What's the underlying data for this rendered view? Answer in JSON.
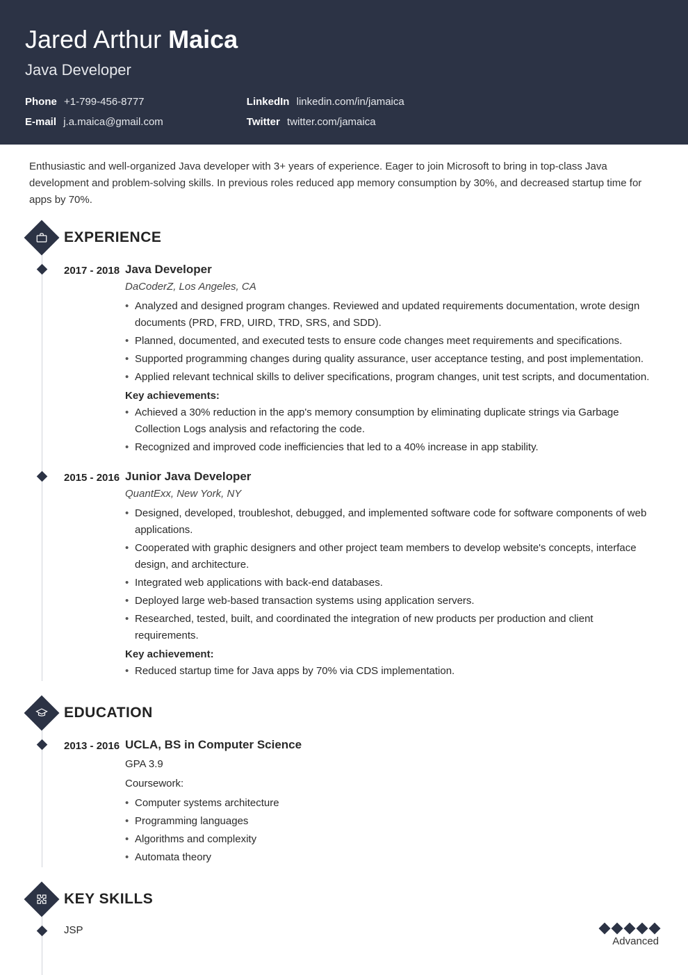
{
  "header": {
    "first_middle": "Jared Arthur",
    "last": "Maica",
    "title": "Java Developer",
    "contacts": {
      "phone_label": "Phone",
      "phone": "+1-799-456-8777",
      "email_label": "E-mail",
      "email": "j.a.maica@gmail.com",
      "linkedin_label": "LinkedIn",
      "linkedin": "linkedin.com/in/jamaica",
      "twitter_label": "Twitter",
      "twitter": "twitter.com/jamaica"
    }
  },
  "summary": "Enthusiastic and well-organized Java developer with 3+ years of experience. Eager to join Microsoft to bring in top-class Java development and problem-solving skills. In previous roles reduced app memory consumption by 30%, and decreased startup time for apps by 70%.",
  "sections": {
    "experience_title": "EXPERIENCE",
    "education_title": "EDUCATION",
    "skills_title": "KEY SKILLS"
  },
  "experience": [
    {
      "dates": "2017 - 2018",
      "title": "Java Developer",
      "sub": "DaCoderZ, Los Angeles, CA",
      "bullets": [
        "Analyzed and designed program changes. Reviewed and updated requirements documentation, wrote design documents (PRD, FRD, UIRD, TRD, SRS, and SDD).",
        "Planned, documented, and executed tests to ensure code changes meet requirements and specifications.",
        "Supported programming changes during quality assurance, user acceptance testing, and post implementation.",
        "Applied relevant technical skills to deliver specifications, program changes, unit test scripts, and documentation."
      ],
      "ach_label": "Key achievements:",
      "achievements": [
        "Achieved a 30% reduction in the app's memory consumption by eliminating duplicate strings via Garbage Collection Logs analysis and refactoring the code.",
        "Recognized and improved code inefficiencies that led to a 40% increase in app stability."
      ]
    },
    {
      "dates": "2015 - 2016",
      "title": "Junior Java Developer",
      "sub": "QuantExx, New York, NY",
      "bullets": [
        "Designed, developed, troubleshot, debugged, and implemented software code for software components of web applications.",
        "Cooperated with graphic designers and other project team members to develop website's concepts, interface design, and architecture.",
        "Integrated web applications with back-end databases.",
        "Deployed large web-based transaction systems using application servers.",
        "Researched, tested, built, and coordinated the integration of new products per production and client requirements."
      ],
      "ach_label": "Key achievement:",
      "achievements": [
        "Reduced startup time for Java apps by 70% via CDS implementation."
      ]
    }
  ],
  "education": [
    {
      "dates": "2013 - 2016",
      "title": "UCLA, BS in Computer Science",
      "gpa": "GPA 3.9",
      "coursework_label": "Coursework:",
      "courses": [
        "Computer systems architecture",
        "Programming languages",
        "Algorithms and complexity",
        "Automata theory"
      ]
    }
  ],
  "skills": [
    {
      "name": "JSP",
      "level": "Advanced",
      "rating": 5
    }
  ]
}
